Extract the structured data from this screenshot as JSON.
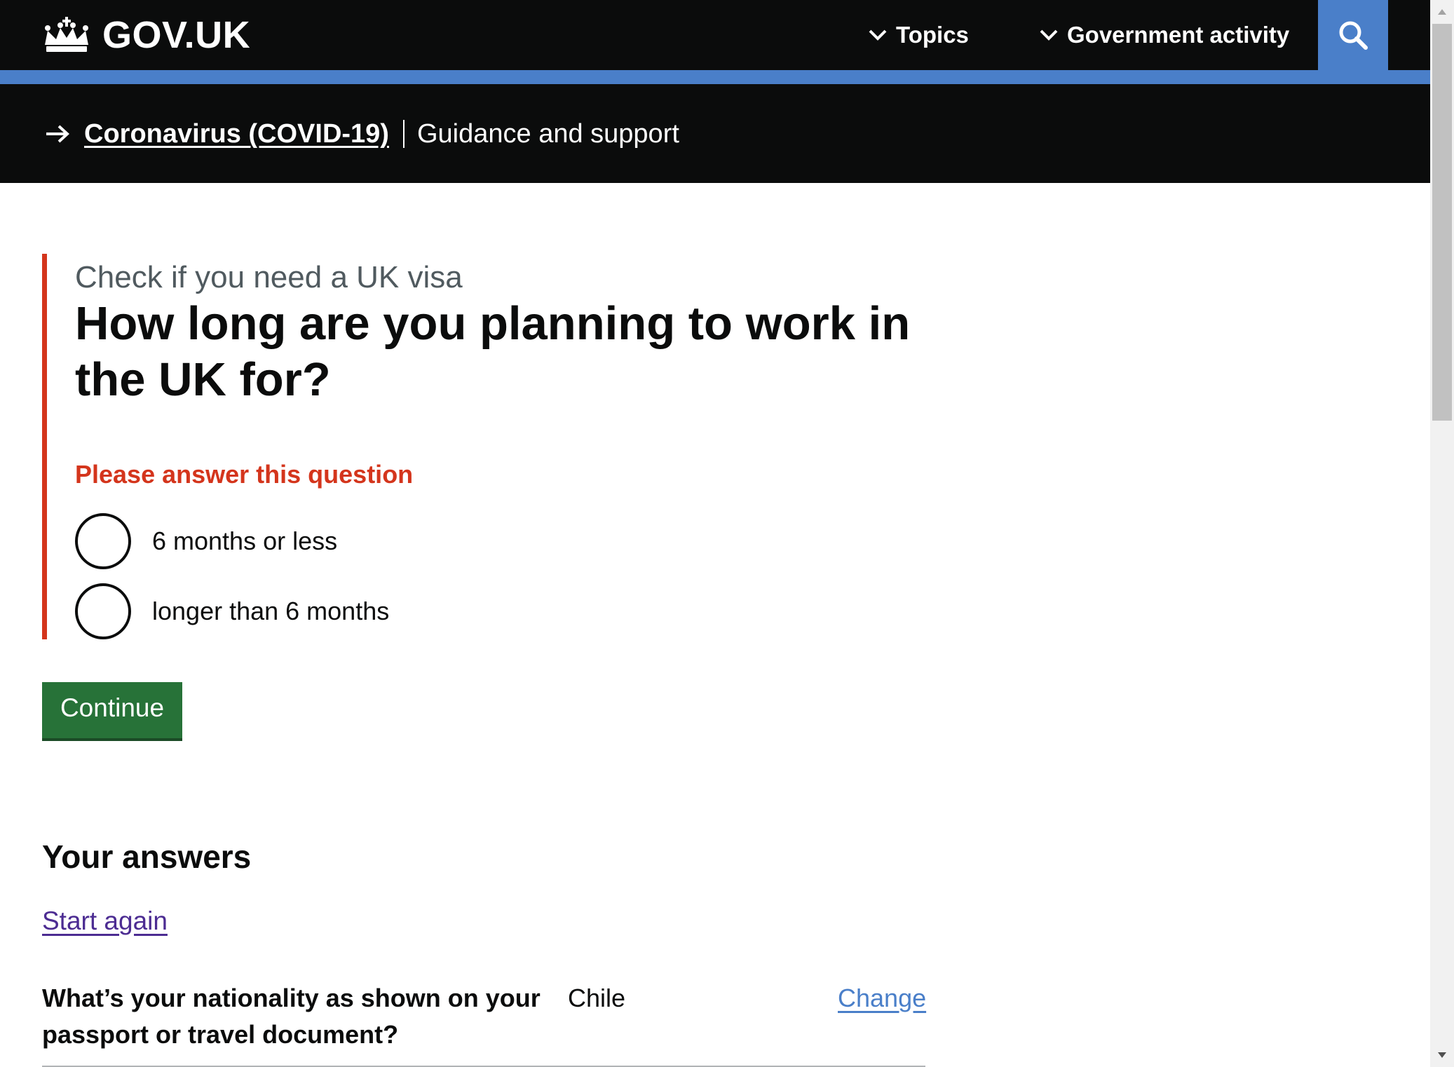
{
  "header": {
    "logo_text": "GOV.UK",
    "nav": [
      {
        "label": "Topics"
      },
      {
        "label": "Government activity"
      }
    ],
    "search_icon": "search-icon",
    "colors": {
      "background": "#0b0c0c",
      "accent": "#4a7fc9"
    }
  },
  "banner": {
    "link_label": "Coronavirus (COVID-19)",
    "text": "Guidance and support"
  },
  "form": {
    "caption": "Check if you need a UK visa",
    "question": "How long are you planning to work in the UK for?",
    "error": "Please answer this question",
    "options": [
      {
        "label": "6 months or less",
        "selected": false
      },
      {
        "label": "longer than 6 months",
        "selected": false
      }
    ],
    "continue_label": "Continue",
    "colors": {
      "error": "#d4351c",
      "button": "#277238"
    }
  },
  "answers": {
    "heading": "Your answers",
    "start_again": "Start again",
    "rows": [
      {
        "question": "What’s your nationality as shown on your passport or travel document?",
        "value": "Chile",
        "action": "Change"
      }
    ]
  }
}
